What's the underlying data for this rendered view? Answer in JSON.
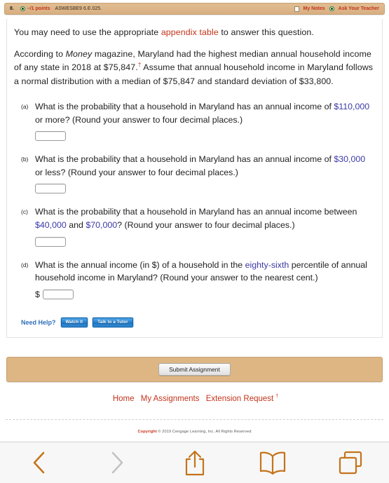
{
  "question_header": {
    "number": "8.",
    "points": "–/1 points",
    "code": "ASWESBE9 6.E.025.",
    "my_notes": "My Notes",
    "ask_teacher": "Ask Your Teacher",
    "accent_color": "#c4341c",
    "bar_color": "#ddb684"
  },
  "intro": {
    "line1_before": "You may need to use the appropriate ",
    "line1_link": "appendix table",
    "line1_after": " to answer this question.",
    "para_part1": "According to ",
    "para_italic": "Money",
    "para_part2": " magazine, Maryland had the highest median annual household income of any state in 2018 at $75,847.",
    "dagger": "†",
    "para_part3": " Assume that annual household income in Maryland follows a normal distribution with a median of $75,847 and standard deviation of $33,800."
  },
  "parts": [
    {
      "label": "(a)",
      "text_before": "What is the probability that a household in Maryland has an annual income of ",
      "value1": "$110,000",
      "text_after": " or more? (Round your answer to four decimal places.)",
      "answer_value": "",
      "answer_placeholder": "",
      "prefix_symbol": ""
    },
    {
      "label": "(b)",
      "text_before": "What is the probability that a household in Maryland has an annual income of ",
      "value1": "$30,000",
      "text_after": " or less? (Round your answer to four decimal places.)",
      "answer_value": "",
      "answer_placeholder": "",
      "prefix_symbol": ""
    },
    {
      "label": "(c)",
      "text_before": "What is the probability that a household in Maryland has an annual income between ",
      "value1": "$40,000",
      "text_middle": " and ",
      "value2": "$70,000",
      "text_after": "? (Round your answer to four decimal places.)",
      "answer_value": "",
      "answer_placeholder": "",
      "prefix_symbol": ""
    },
    {
      "label": "(d)",
      "text_before": "What is the annual income (in $) of a household in the ",
      "value1": "eighty-sixth",
      "text_after": " percentile of annual household income in Maryland? (Round your answer to the nearest cent.)",
      "answer_value": "",
      "answer_placeholder": "",
      "prefix_symbol": "$"
    }
  ],
  "need_help": {
    "label": "Need Help?",
    "watch_it": "Watch It",
    "talk_tutor": "Talk to a Tutor"
  },
  "submit": {
    "label": "Submit Assignment"
  },
  "footer": {
    "links": [
      "Home",
      "My Assignments",
      "Extension Request"
    ],
    "extension_dagger": "†",
    "copyright_bold": "Copyright",
    "copyright_rest": " © 2019 Cengage Learning, Inc. All Rights Reserved"
  },
  "toolbar": {
    "back": "back-icon",
    "forward": "forward-icon",
    "share": "share-icon",
    "bookmarks": "bookmarks-icon",
    "tabs": "tabs-icon",
    "active_color": "#c4741c",
    "disabled_color": "#c0c0c0"
  }
}
